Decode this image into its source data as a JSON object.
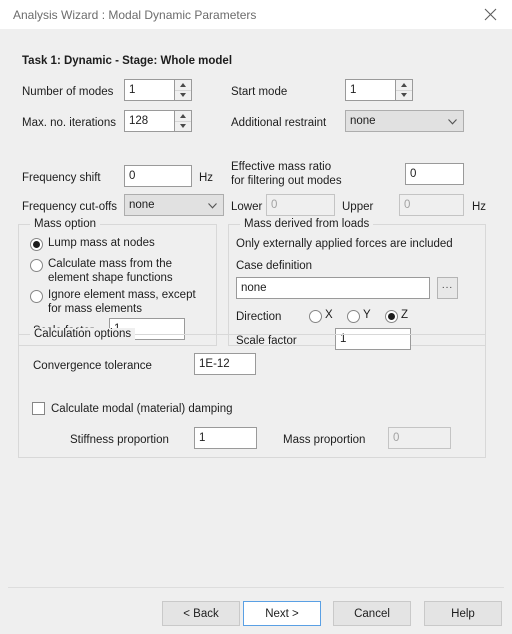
{
  "window": {
    "title": "Analysis Wizard : Modal Dynamic Parameters",
    "close_icon": "close-icon"
  },
  "task_line": "Task 1: Dynamic  -  Stage: Whole model",
  "fields": {
    "number_of_modes": {
      "label": "Number of modes",
      "value": "1"
    },
    "start_mode": {
      "label": "Start mode",
      "value": "1"
    },
    "max_no_iterations": {
      "label": "Max. no. iterations",
      "value": "128"
    },
    "additional_restraint": {
      "label": "Additional restraint",
      "value": "none",
      "options": [
        "none"
      ]
    },
    "frequency_shift": {
      "label": "Frequency shift",
      "value": "0",
      "unit": "Hz"
    },
    "effective_mass_ratio": {
      "label": "Effective mass ratio for filtering out modes",
      "value": "0"
    },
    "frequency_cutoffs": {
      "label": "Frequency cut-offs",
      "value": "none",
      "options": [
        "none"
      ]
    },
    "lower": {
      "label": "Lower",
      "value": "0"
    },
    "upper": {
      "label": "Upper",
      "value": "0",
      "unit": "Hz"
    }
  },
  "mass_option": {
    "title": "Mass option",
    "radios": [
      {
        "label": "Lump mass at nodes",
        "selected": true
      },
      {
        "label": "Calculate mass from the element shape functions",
        "selected": false
      },
      {
        "label": "Ignore element mass, except for mass elements",
        "selected": false
      }
    ],
    "scale_factor": {
      "label": "Scale factor",
      "value": "1"
    }
  },
  "mass_from_loads": {
    "title": "Mass derived from loads",
    "note": "Only externally applied forces are included",
    "case_definition": {
      "label": "Case definition",
      "value": "none",
      "browse_label": "..."
    },
    "direction": {
      "label": "Direction",
      "options": [
        {
          "label": "X",
          "selected": false
        },
        {
          "label": "Y",
          "selected": false
        },
        {
          "label": "Z",
          "selected": true
        }
      ]
    },
    "scale_factor": {
      "label": "Scale factor",
      "value": "1"
    }
  },
  "calculation_options": {
    "title": "Calculation options",
    "convergence_tolerance": {
      "label": "Convergence tolerance",
      "value": "1E-12"
    },
    "modal_damping": {
      "label": "Calculate modal (material) damping",
      "checked": false
    },
    "stiffness_proportion": {
      "label": "Stiffness proportion",
      "value": "1"
    },
    "mass_proportion": {
      "label": "Mass proportion",
      "value": "0"
    }
  },
  "buttons": {
    "back": "< Back",
    "next": "Next >",
    "cancel": "Cancel",
    "help": "Help"
  }
}
